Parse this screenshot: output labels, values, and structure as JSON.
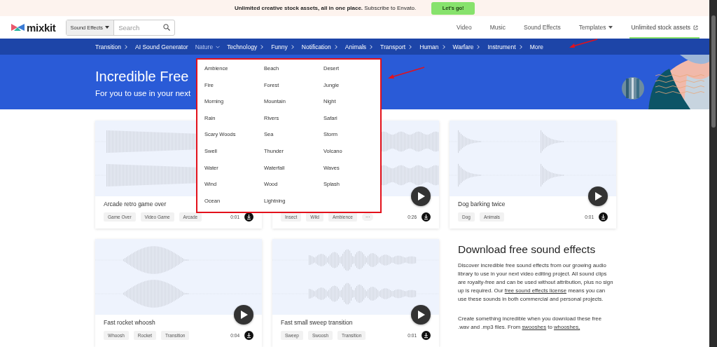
{
  "promo_bar": {
    "text": "**Unlimited creative stock assets, all in one place.** Subscribe to Envato.",
    "button": "Let's go!"
  },
  "header": {
    "logo": "mixkit",
    "search": {
      "category": "Sound Effects",
      "placeholder": "Search"
    },
    "links": [
      {
        "label": "Video",
        "kind": "link",
        "highlighted": false
      },
      {
        "label": "Music",
        "kind": "link",
        "highlighted": false
      },
      {
        "label": "Sound Effects",
        "kind": "link",
        "highlighted": false
      },
      {
        "label": "Templates",
        "kind": "dropdown",
        "highlighted": false
      },
      {
        "label": "Unlimited stock assets",
        "kind": "external",
        "highlighted": true
      }
    ]
  },
  "category_nav": [
    {
      "label": "Transition",
      "chevron": true,
      "selected": false
    },
    {
      "label": "AI Sound Generator",
      "chevron": false,
      "selected": false
    },
    {
      "label": "Nature",
      "chevron": true,
      "selected": true
    },
    {
      "label": "Technology",
      "chevron": true,
      "selected": false
    },
    {
      "label": "Funny",
      "chevron": true,
      "selected": false
    },
    {
      "label": "Notification",
      "chevron": true,
      "selected": false
    },
    {
      "label": "Animals",
      "chevron": true,
      "selected": false
    },
    {
      "label": "Transport",
      "chevron": true,
      "selected": false
    },
    {
      "label": "Human",
      "chevron": true,
      "selected": false
    },
    {
      "label": "Warfare",
      "chevron": true,
      "selected": false
    },
    {
      "label": "Instrument",
      "chevron": true,
      "selected": false
    },
    {
      "label": "More",
      "chevron": false,
      "selected": false
    }
  ],
  "dropdown": {
    "items": [
      "Ambience",
      "Beach",
      "Desert",
      "Fire",
      "Forest",
      "Jungle",
      "Morning",
      "Mountain",
      "Night",
      "Rain",
      "Rivers",
      "Safari",
      "Scary Woods",
      "Sea",
      "Storm",
      "Swell",
      "Thunder",
      "Volcano",
      "Water",
      "Waterfall",
      "Waves",
      "Wind",
      "Wood",
      "Splash",
      "Ocean",
      "Lightning"
    ]
  },
  "hero": {
    "title": "Incredible Free",
    "subtitle": "For you to use in your next"
  },
  "cards": [
    {
      "title": "Arcade retro game over",
      "tags": [
        "Game Over",
        "Video Game",
        "Arcade"
      ],
      "duration": "0:01"
    },
    {
      "tags": [
        "Insect",
        "Wild",
        "Ambience"
      ],
      "more": "···",
      "duration": "0:26",
      "play": true
    },
    {
      "title": "Dog barking twice",
      "tags": [
        "Dog",
        "Animals"
      ],
      "duration": "0:01",
      "play": true
    },
    {
      "title": "Fast rocket whoosh",
      "tags": [
        "Whoosh",
        "Rocket",
        "Transition"
      ],
      "duration": "0:04",
      "play": true
    },
    {
      "title": "Fast small sweep transition",
      "tags": [
        "Sweep",
        "Swoosh",
        "Transition"
      ],
      "duration": "0:01",
      "play": true
    }
  ],
  "about": {
    "heading": "Download free sound effects",
    "paragraphs": [
      [
        {
          "text": "Discover incredible free sound effects from our growing audio library to use in your next video editing project. All sound clips are royalty-free and can be used without attribution, plus no sign up is required. Our "
        },
        {
          "text": "free sound effects license",
          "link": true
        },
        {
          "text": " means you can use these sounds in both commercial and personal projects."
        }
      ],
      [
        {
          "text": "Create something incredible when you download these free .wav and .mp3 files. From "
        },
        {
          "text": "swooshes",
          "link": true
        },
        {
          "text": " to "
        },
        {
          "text": "whooshes,",
          "link": true
        }
      ]
    ]
  }
}
